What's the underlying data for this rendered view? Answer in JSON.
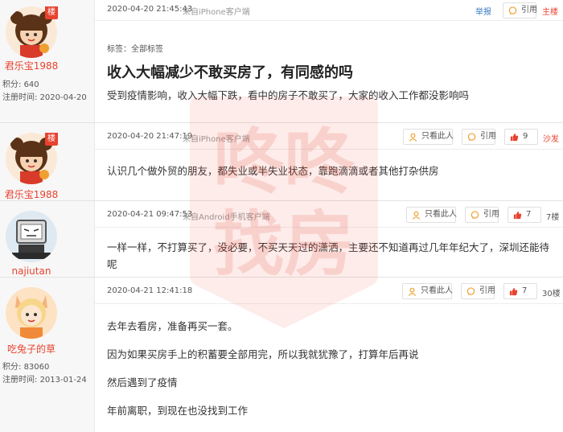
{
  "posts": [
    {
      "author": "君乐宝1988",
      "badge": "楼",
      "stats": {
        "score_label": "积分:",
        "score": "640",
        "reg_label": "注册时间:",
        "reg": "2020-04-20"
      },
      "time": "2020-04-20 21:45:43",
      "source": "来自iPhone客户端",
      "report": "举报",
      "quote": "引用",
      "floor": "主楼",
      "tags": "标签：全部标签",
      "title": "收入大幅减少不敢买房了，有同感的吗",
      "lines": [
        "受到疫情影响，收入大幅下跌，看中的房子不敢买了，大家的收入工作都没影响吗"
      ]
    },
    {
      "author": "君乐宝1988",
      "badge": "楼",
      "time": "2020-04-20 21:47:19",
      "source": "来自iPhone客户端",
      "only": "只看此人",
      "quote": "引用",
      "likes": "9",
      "floor": "沙发",
      "lines": [
        "认识几个做外贸的朋友，都失业或半失业状态，靠跑滴滴或者其他打杂供房"
      ]
    },
    {
      "author": "najiutan",
      "time": "2020-04-21 09:47:53",
      "source": "来自Android手机客户端",
      "only": "只看此人",
      "quote": "引用",
      "likes": "7",
      "floor": "7楼",
      "lines": [
        "一样一样，不打算买了，没必要，不买天天过的潇洒，主要还不知道再过几年年纪大了，深圳还能待",
        "呢"
      ]
    },
    {
      "author": "吃兔子的草",
      "stats": {
        "score_label": "积分:",
        "score": "83060",
        "reg_label": "注册时间:",
        "reg": "2013-01-24"
      },
      "time": "2020-04-21 12:41:18",
      "only": "只看此人",
      "quote": "引用",
      "likes": "7",
      "floor": "30楼",
      "lines": [
        "去年去看房，准备再买一套。",
        "因为如果买房手上的积蓄要全部用完，所以我就犹豫了，打算年后再说",
        "然后遇到了疫情",
        "年前离职，到现在也没找到工作"
      ]
    }
  ],
  "watermark": {
    "line1": "咚咚",
    "line2": "找房",
    "color": "#e8422f"
  }
}
